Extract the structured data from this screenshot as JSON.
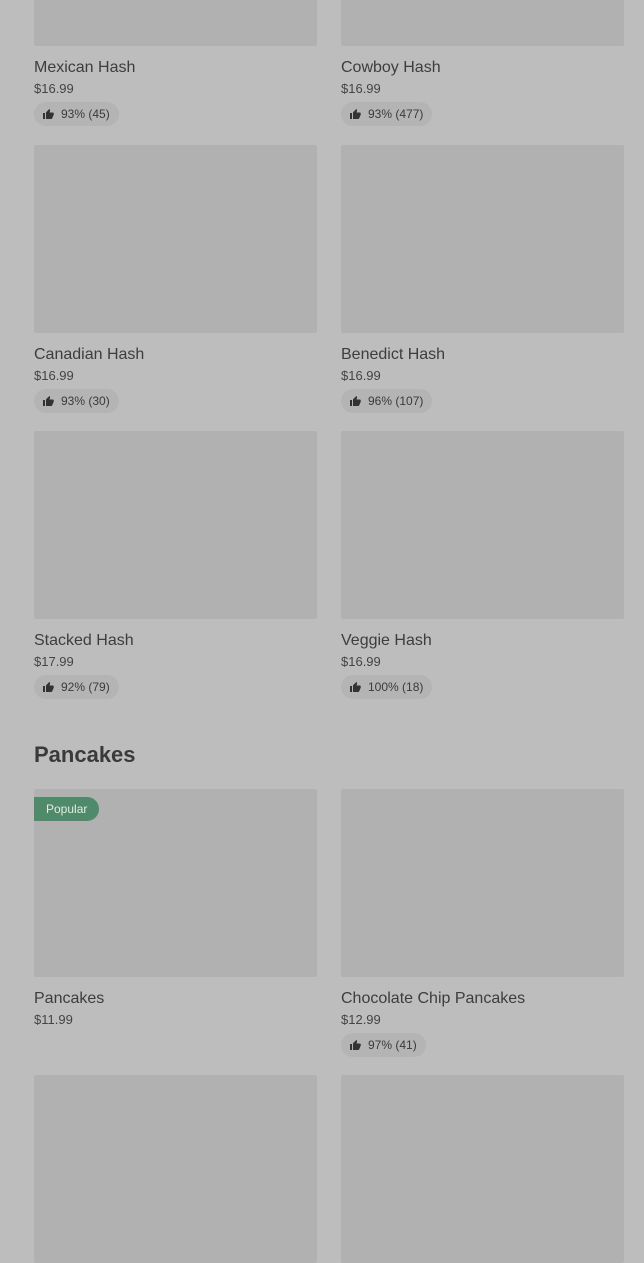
{
  "items_top": [
    {
      "name": "Mexican Hash",
      "price": "$16.99",
      "rating": "93% (45)"
    },
    {
      "name": "Cowboy Hash",
      "price": "$16.99",
      "rating": "93% (477)"
    }
  ],
  "items_row2": [
    {
      "name": "Canadian Hash",
      "price": "$16.99",
      "rating": "93% (30)"
    },
    {
      "name": "Benedict Hash",
      "price": "$16.99",
      "rating": "96% (107)"
    }
  ],
  "items_row3": [
    {
      "name": "Stacked Hash",
      "price": "$17.99",
      "rating": "92% (79)"
    },
    {
      "name": "Veggie Hash",
      "price": "$16.99",
      "rating": "100% (18)"
    }
  ],
  "pancakes": {
    "title": "Pancakes",
    "items": [
      {
        "name": "Pancakes",
        "price": "$11.99",
        "badge": "Popular"
      },
      {
        "name": "Chocolate Chip Pancakes",
        "price": "$12.99",
        "rating": "97% (41)"
      }
    ]
  },
  "icons": {
    "rating": "thumbs-up-icon"
  },
  "colors": {
    "background": "#bdbdbd",
    "image_placeholder": "#b1b1b1",
    "badge": "#4f8a6a"
  }
}
